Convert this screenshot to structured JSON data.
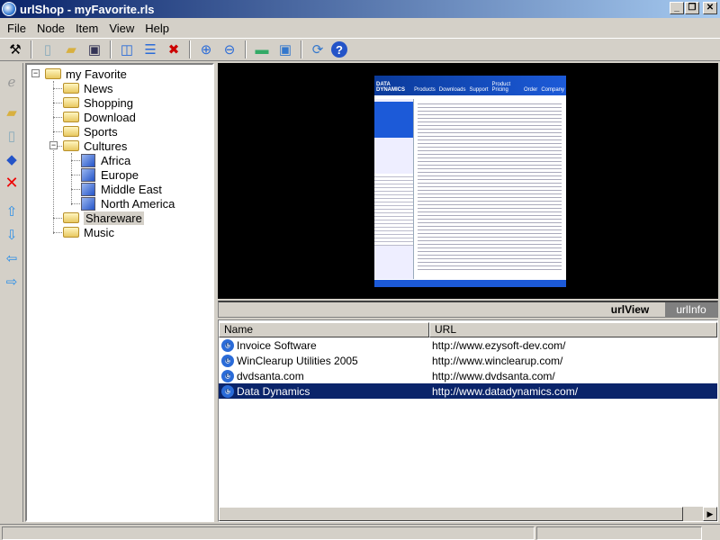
{
  "window": {
    "title": "urlShop - myFavorite.rls",
    "controls": [
      "_",
      "❐",
      "✕"
    ]
  },
  "menu": [
    "File",
    "Node",
    "Item",
    "View",
    "Help"
  ],
  "toolbar": {
    "icons": [
      "tools-icon",
      "new-icon",
      "open-icon",
      "save-icon",
      "window-icon",
      "list-view-icon",
      "delete-item-icon",
      "zoom-in-icon",
      "zoom-out-icon",
      "picture-icon",
      "screen-icon",
      "refresh-icon",
      "help-icon"
    ]
  },
  "sidetoolbar": {
    "icons": [
      "ie-icon",
      "folder-icon",
      "page-icon",
      "book-icon",
      "delete-icon",
      "up-arrow-icon",
      "down-arrow-icon",
      "left-arrow-icon",
      "right-arrow-icon"
    ]
  },
  "tree": {
    "root": "my Favorite",
    "items": [
      "News",
      "Shopping",
      "Download",
      "Sports",
      "Cultures",
      "Shareware",
      "Music"
    ],
    "cultures": [
      "Africa",
      "Europe",
      "Middle East",
      "North America"
    ],
    "selected": "Shareware"
  },
  "preview": {
    "site_logo": "DATA DYNAMICS",
    "nav": [
      "Products",
      "Downloads",
      "Support",
      "Product Pricing",
      "Order",
      "Company"
    ]
  },
  "tabs": {
    "active": "urlView",
    "inactive": "urlInfo"
  },
  "list": {
    "columns": [
      "Name",
      "URL"
    ],
    "rows": [
      {
        "name": "Invoice Software",
        "url": "http://www.ezysoft-dev.com/"
      },
      {
        "name": "WinClearup Utilities 2005",
        "url": "http://www.winclearup.com/"
      },
      {
        "name": "dvdsanta.com",
        "url": "http://www.dvdsanta.com/"
      },
      {
        "name": "Data Dynamics",
        "url": "http://www.datadynamics.com/"
      }
    ],
    "selected_index": 3
  },
  "colors": {
    "titlebar": "#0a246a",
    "selection": "#0a246a",
    "tab_inactive": "#808080"
  }
}
